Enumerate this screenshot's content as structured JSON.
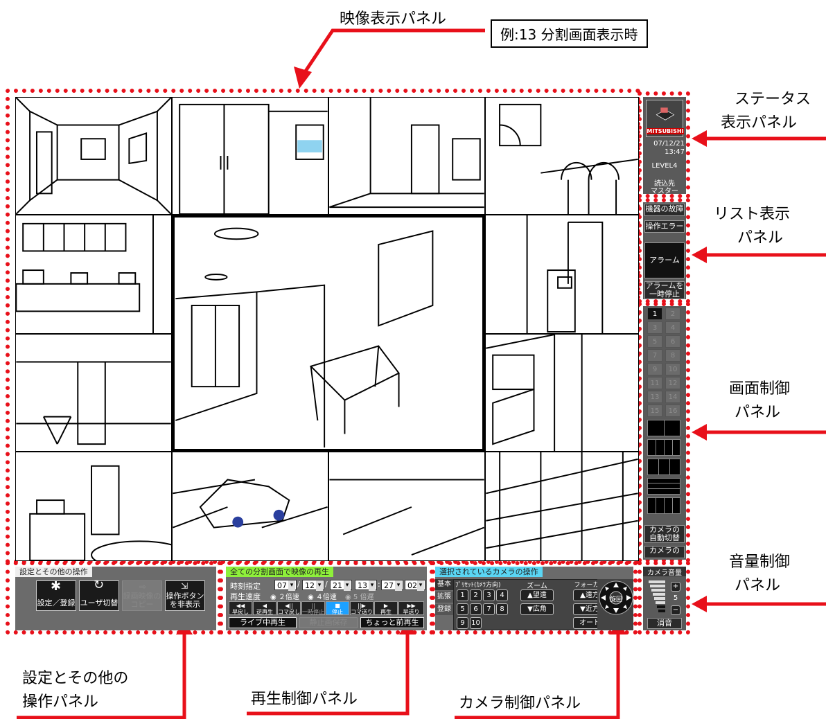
{
  "callouts": {
    "video_panel": "映像表示パネル",
    "example": "例:13 分割画面表示時",
    "status_panel_line1": "ステータス",
    "status_panel_line2": "表示パネル",
    "list_panel_line1": "リスト表示",
    "list_panel_line2": "パネル",
    "screen_panel_line1": "画面制御",
    "screen_panel_line2": "パネル",
    "volume_panel_line1": "音量制御",
    "volume_panel_line2": "パネル",
    "settings_panel_line1": "設定とその他の",
    "settings_panel_line2": "操作パネル",
    "playback_panel": "再生制御パネル",
    "camera_panel": "カメラ制御パネル"
  },
  "status": {
    "brand": "MITSUBISHI",
    "date": "07/12/21",
    "time": "13:47",
    "level": "LEVEL4",
    "load_line1": "読込先",
    "load_line2": "マスター"
  },
  "list": {
    "device_fault": "機器の故障",
    "operation_error": "操作エラー",
    "alarm": "アラーム",
    "pause_alarm_line1": "アラームを",
    "pause_alarm_line2": "一時停止"
  },
  "screen_control": {
    "numbers": [
      "1",
      "2",
      "3",
      "4",
      "5",
      "6",
      "7",
      "8",
      "9",
      "10",
      "11",
      "12",
      "13",
      "14",
      "15",
      "16"
    ],
    "auto_switch_line1": "カメラの",
    "auto_switch_line2": "自動切替",
    "cut_line1": "カメラの"
  },
  "settings": {
    "title": "設定とその他の操作",
    "settings_register": "設定／登録",
    "user_switch": "ユーザ切替",
    "copy_line1": "録画映像の",
    "copy_line2": "コピー",
    "hide_line1": "操作ボタン",
    "hide_line2": "を非表示"
  },
  "playback": {
    "title": "全ての分割画面で映像の再生",
    "time_label": "時刻指定",
    "speed_label": "再生速度",
    "year": "07",
    "month": "12",
    "day": "21",
    "hour": "13",
    "minute": "27",
    "second": "02",
    "speed_2x": "２倍速",
    "speed_4x": "４倍速",
    "speed_slow": "5 倍遅",
    "btn_rewind": "早戻し",
    "btn_reverse": "逆再生",
    "btn_frame_back": "コマ戻し",
    "btn_pause": "一時停止",
    "btn_stop": "停止",
    "btn_frame_fwd": "コマ送り",
    "btn_play": "再生",
    "btn_ff": "早送り",
    "live_play": "ライブ中再生",
    "save_still": "静止画保存",
    "replay_before": "ちょっと前再生"
  },
  "camera": {
    "title": "選択されているカメラの操作",
    "tab_basic": "基本",
    "tab_extend": "拡張",
    "tab_register": "登録",
    "preset_label": "ﾌﾟﾘｾｯﾄ(ｶﾒﾗ方向)",
    "presets": [
      "1",
      "2",
      "3",
      "4",
      "5",
      "6",
      "7",
      "8",
      "9",
      "10"
    ],
    "zoom_label": "ズーム",
    "zoom_tele": "▲望遠",
    "zoom_wide": "▼広角",
    "focus_label": "フォーカス",
    "focus_far": "▲遠方",
    "focus_near": "▼近方",
    "focus_auto": "オート",
    "rotate": "旋回"
  },
  "volume": {
    "title": "カメラ音量",
    "level": "5",
    "mute": "消音"
  }
}
